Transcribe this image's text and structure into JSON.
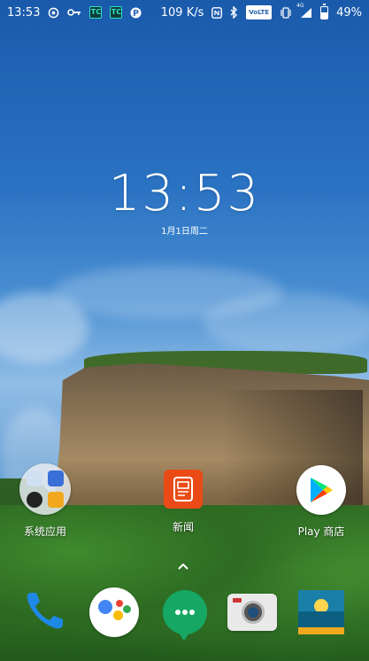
{
  "status_bar": {
    "time": "13:53",
    "network_speed": "109 K/s",
    "volte": "VoLTE",
    "signal_label": "4G",
    "battery_percent": "49%",
    "battery_level": 0.49,
    "left_icons": [
      "netease-music-icon",
      "key-icon",
      "tc-app-icon",
      "tc-app-icon",
      "p-app-icon"
    ],
    "right_icons": [
      "nfc-icon",
      "bluetooth-icon",
      "vibrate-icon",
      "signal-icon",
      "battery-icon"
    ],
    "tc_label": "TC"
  },
  "clock": {
    "time": "13:53",
    "date": "1月1日周二"
  },
  "apps": [
    {
      "label": "系统应用",
      "icon": "folder-icon"
    },
    {
      "label": "新闻",
      "icon": "news-icon"
    },
    {
      "label": "Play 商店",
      "icon": "play-store-icon"
    }
  ],
  "dock": [
    {
      "name": "phone",
      "icon": "phone-icon"
    },
    {
      "name": "assistant",
      "icon": "google-assistant-icon"
    },
    {
      "name": "hangouts",
      "icon": "hangouts-icon"
    },
    {
      "name": "camera",
      "icon": "camera-icon"
    },
    {
      "name": "gallery",
      "icon": "gallery-icon"
    }
  ],
  "colors": {
    "news": "#ea4b16",
    "hangouts": "#16a765",
    "phone": "#1e88e5"
  }
}
